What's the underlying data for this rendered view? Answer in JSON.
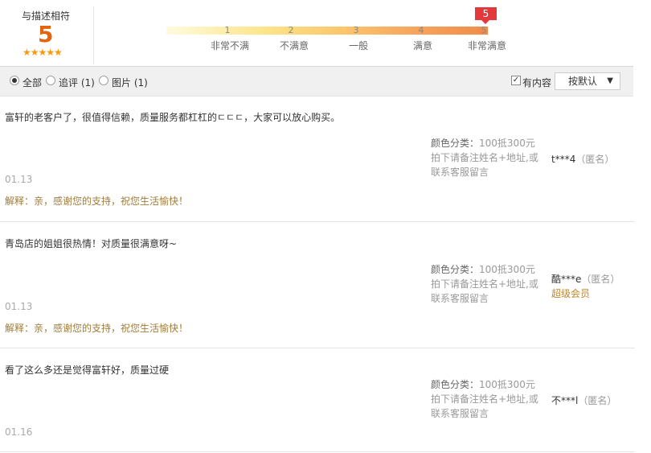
{
  "summary": {
    "title": "与描述相符",
    "score": "5",
    "stars": "★★★★★",
    "ticks": [
      "1",
      "2",
      "3",
      "4",
      "5"
    ],
    "levels": [
      "非常不满",
      "不满意",
      "一般",
      "满意",
      "非常满意"
    ],
    "badge": "5"
  },
  "filters": {
    "all": "全部",
    "followup": "追评 (1)",
    "pictures": "图片 (1)",
    "has_content": "有内容",
    "sort": "按默认"
  },
  "reviews": [
    {
      "text": "富轩的老客户了，很值得信赖，质量服务都杠杠的ㄷㄷㄷ，大家可以放心购买。",
      "sku_key": "颜色分类：",
      "sku_val": "100抵300元",
      "sku_note": "拍下请备注姓名+地址,或联系客服留言",
      "user": "t***4",
      "anon": "（匿名）",
      "vip": "",
      "date": "01.13",
      "reply": "解释：亲，感谢您的支持，祝您生活愉快！"
    },
    {
      "text": "青岛店的姐姐很热情！对质量很满意呀~",
      "sku_key": "颜色分类：",
      "sku_val": "100抵300元",
      "sku_note": "拍下请备注姓名+地址,或联系客服留言",
      "user": "酷***e",
      "anon": "（匿名）",
      "vip": "超级会员",
      "date": "01.13",
      "reply": "解释：亲，感谢您的支持，祝您生活愉快！"
    },
    {
      "text": "看了这么多还是觉得富轩好，质量过硬",
      "sku_key": "颜色分类：",
      "sku_val": "100抵300元",
      "sku_note": "拍下请备注姓名+地址,或联系客服留言",
      "user": "不***l",
      "anon": "（匿名）",
      "vip": "",
      "date": "01.16",
      "reply": ""
    }
  ]
}
